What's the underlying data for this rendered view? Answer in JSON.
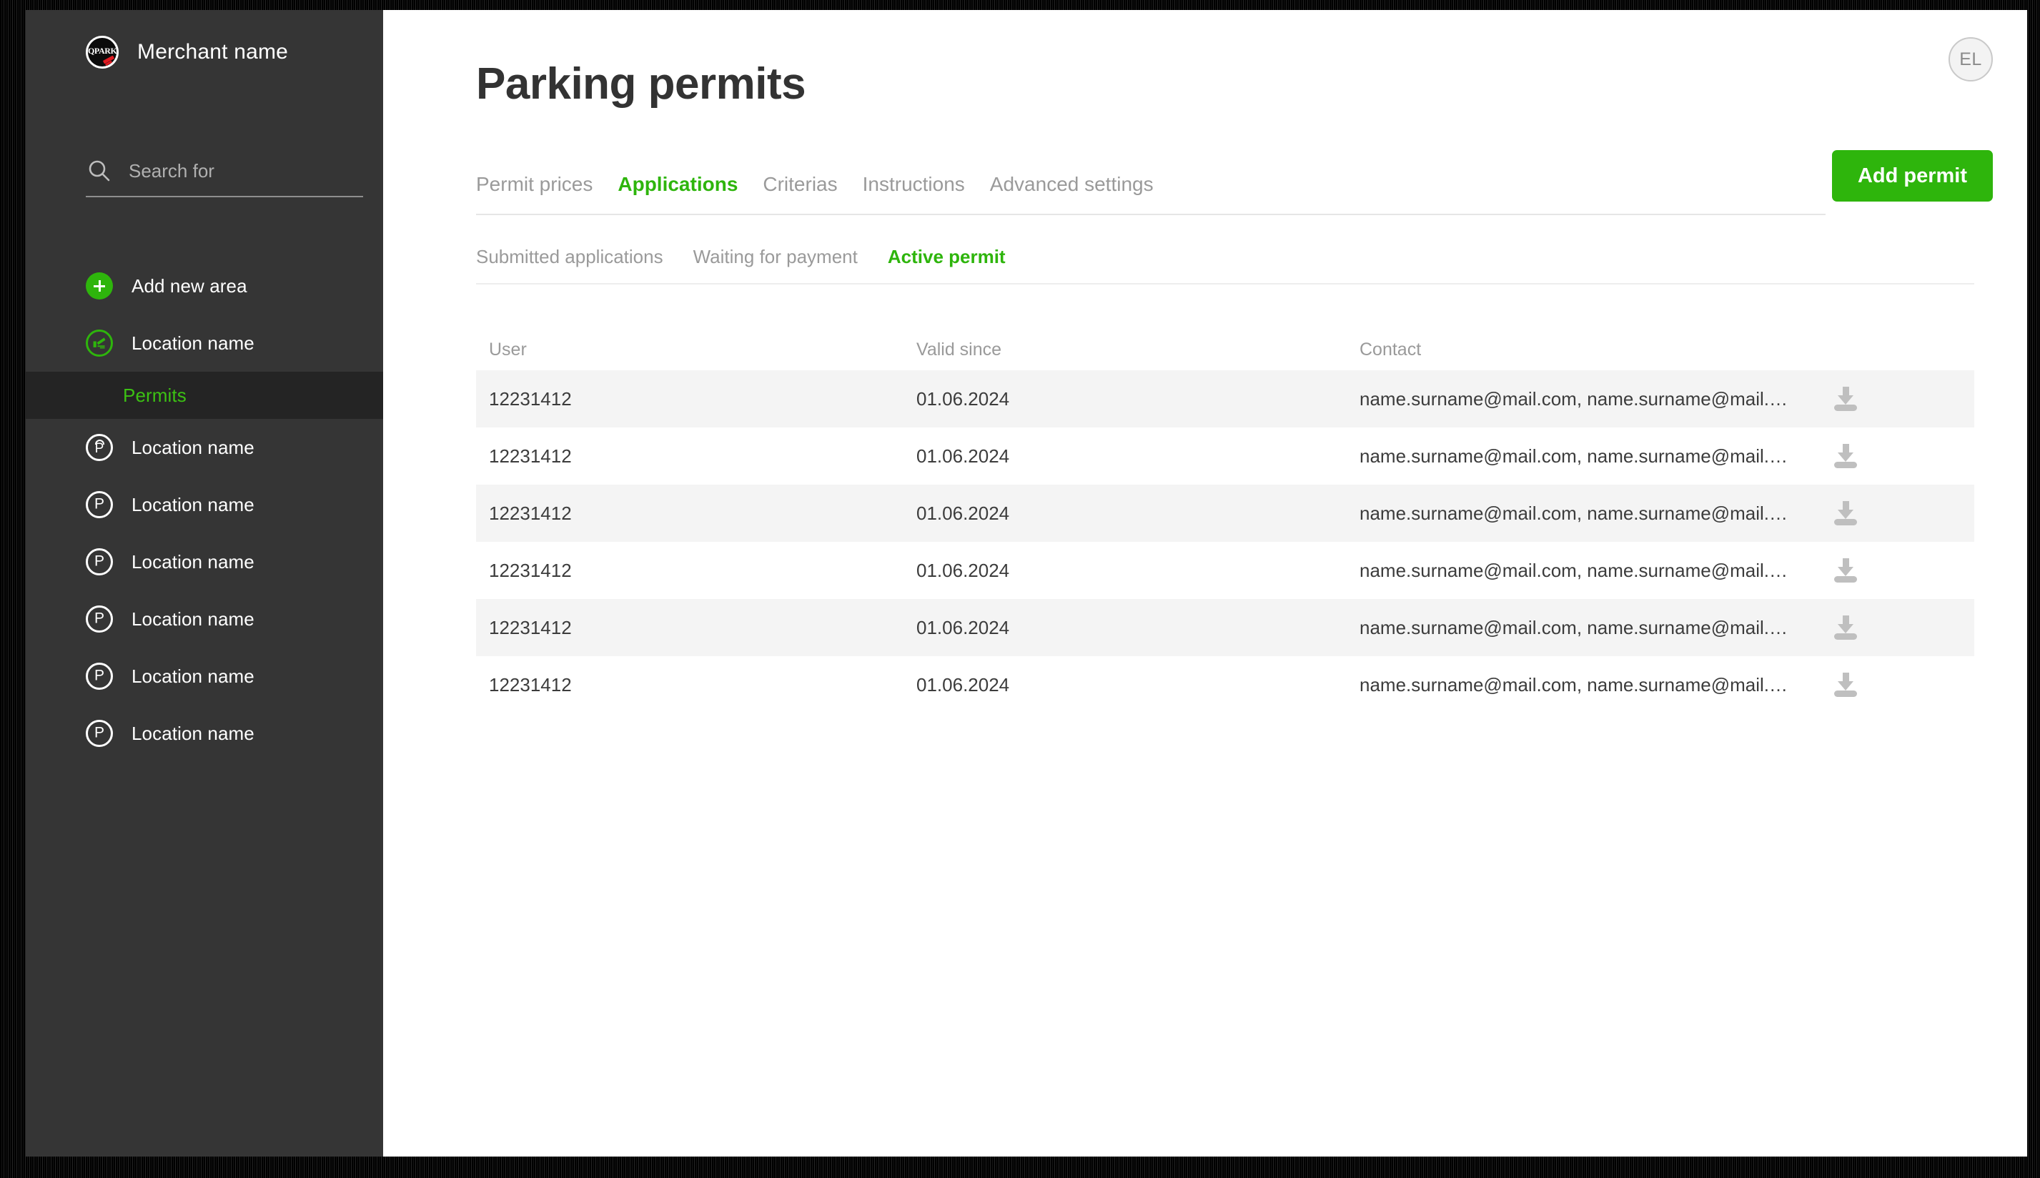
{
  "colors": {
    "accent_green": "#2eb50c",
    "sidebar_bg": "#353535",
    "sidebar_active_bg": "#242424",
    "row_stripe": "#f4f4f4",
    "muted_text": "#9a9a9a"
  },
  "sidebar": {
    "brand": {
      "name": "Merchant name",
      "logo_text": "QPARK"
    },
    "search": {
      "value": "",
      "placeholder": "Search for"
    },
    "items": [
      {
        "label": "Add new area",
        "icon": "plus-circle-icon",
        "active": false
      },
      {
        "label": "Location name",
        "icon": "barrier-circle-icon",
        "active": false
      },
      {
        "label": "Permits",
        "icon": "none",
        "active": true,
        "sub": true
      },
      {
        "label": "Location name",
        "icon": "parking-wifi-icon",
        "active": false
      },
      {
        "label": "Location name",
        "icon": "parking-icon",
        "active": false
      },
      {
        "label": "Location name",
        "icon": "parking-icon",
        "active": false
      },
      {
        "label": "Location name",
        "icon": "parking-icon",
        "active": false
      },
      {
        "label": "Location name",
        "icon": "parking-icon",
        "active": false
      },
      {
        "label": "Location name",
        "icon": "parking-icon",
        "active": false
      }
    ]
  },
  "header": {
    "title": "Parking permits",
    "avatar_initials": "EL",
    "add_button": "Add permit"
  },
  "tabs": [
    {
      "label": "Permit prices",
      "active": false
    },
    {
      "label": "Applications",
      "active": true
    },
    {
      "label": "Criterias",
      "active": false
    },
    {
      "label": "Instructions",
      "active": false
    },
    {
      "label": "Advanced settings",
      "active": false
    }
  ],
  "subtabs": [
    {
      "label": "Submitted applications",
      "active": false
    },
    {
      "label": "Waiting for payment",
      "active": false
    },
    {
      "label": "Active permit",
      "active": true
    }
  ],
  "table": {
    "columns": [
      "User",
      "Valid since",
      "Contact",
      ""
    ],
    "download_icon": "download-icon",
    "rows": [
      {
        "user": "12231412",
        "valid_since": "01.06.2024",
        "contact": "name.surname@mail.com, name.surname@mail.co…"
      },
      {
        "user": "12231412",
        "valid_since": "01.06.2024",
        "contact": "name.surname@mail.com, name.surname@mail.co…"
      },
      {
        "user": "12231412",
        "valid_since": "01.06.2024",
        "contact": "name.surname@mail.com, name.surname@mail.co…"
      },
      {
        "user": "12231412",
        "valid_since": "01.06.2024",
        "contact": "name.surname@mail.com, name.surname@mail.co…"
      },
      {
        "user": "12231412",
        "valid_since": "01.06.2024",
        "contact": "name.surname@mail.com, name.surname@mail.co…"
      },
      {
        "user": "12231412",
        "valid_since": "01.06.2024",
        "contact": "name.surname@mail.com, name.surname@mail.co…"
      }
    ]
  }
}
